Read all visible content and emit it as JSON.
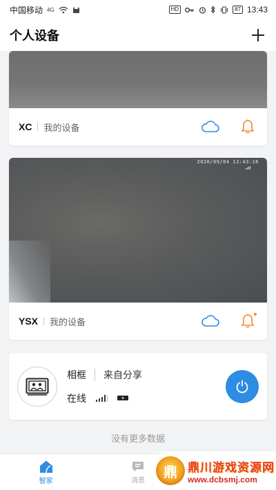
{
  "status_bar": {
    "carrier": "中国移动",
    "network": "4G",
    "hd": "HD",
    "battery": "87",
    "time": "13:43"
  },
  "header": {
    "title": "个人设备",
    "add_icon": "plus-icon"
  },
  "devices": [
    {
      "name": "XC",
      "owner": "我的设备",
      "cloud_icon": "cloud-icon",
      "bell_icon": "bell-icon",
      "has_notification": false
    },
    {
      "name": "YSX",
      "owner": "我的设备",
      "timestamp": "2020/09/04 13:43:16",
      "cloud_icon": "cloud-icon",
      "bell_icon": "bell-icon",
      "has_notification": true
    }
  ],
  "frame_device": {
    "name": "相框",
    "share": "来自分享",
    "status": "在线",
    "avatar_icon": "photo-frame-icon",
    "power_icon": "power-icon"
  },
  "no_more": "没有更多数据",
  "tabs": [
    {
      "label": "智家",
      "icon": "home-icon",
      "active": true
    },
    {
      "label": "消息",
      "icon": "message-icon",
      "active": false
    }
  ],
  "watermark": {
    "title": "鼎川游戏资源网",
    "url": "www.dcbsmj.com"
  },
  "colors": {
    "accent": "#2d8ce3",
    "bell": "#f08a2a",
    "cloud": "#2d8ce3"
  }
}
